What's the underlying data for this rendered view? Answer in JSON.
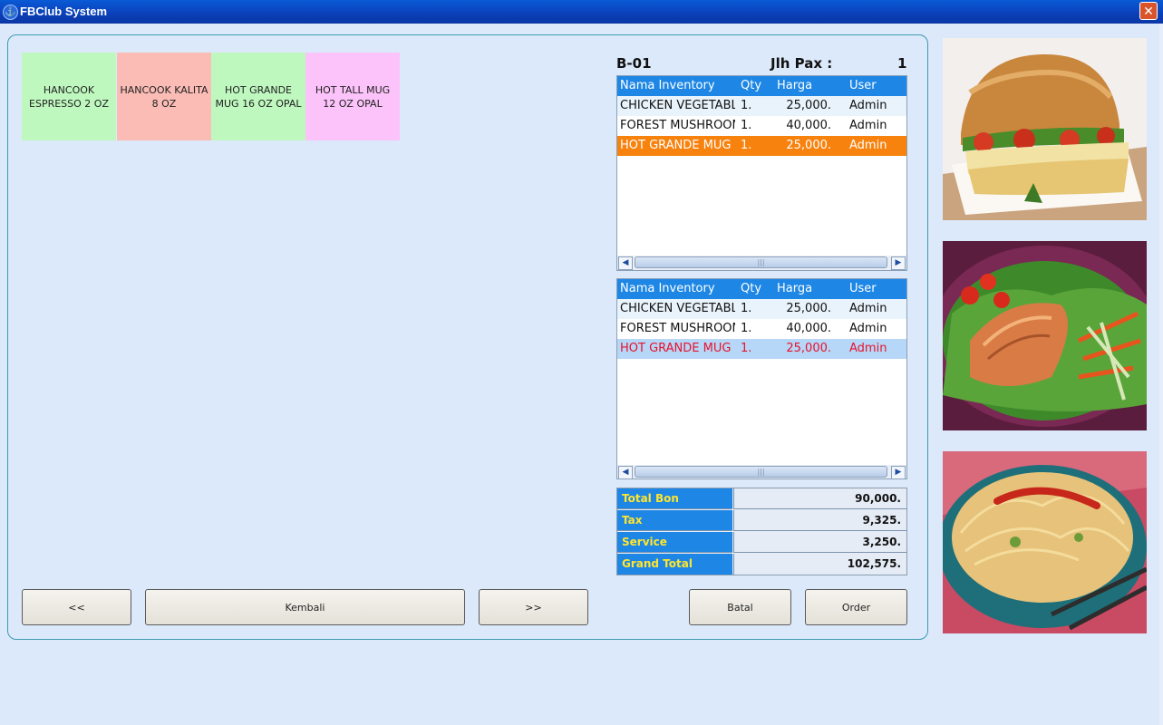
{
  "window": {
    "title": "FBClub System"
  },
  "menu_tiles": [
    {
      "label": "HANCOOK ESPRESSO 2 OZ",
      "color": "#bff8bf"
    },
    {
      "label": "HANCOOK KALITA 8 OZ",
      "color": "#fbbcb6"
    },
    {
      "label": "HOT GRANDE MUG 16 OZ OPAL",
      "color": "#bff8bf"
    },
    {
      "label": "HOT TALL MUG 12 OZ OPAL",
      "color": "#fbc3f9"
    }
  ],
  "order_header": {
    "table": "B-01",
    "pax_label": "Jlh Pax :",
    "pax_value": "1"
  },
  "columns": [
    "Nama Inventory",
    "Qty",
    "Harga",
    "User"
  ],
  "grid_top": {
    "rows": [
      {
        "name": "CHICKEN VEGETABLE",
        "qty": "1.",
        "price": "25,000.",
        "user": "Admin"
      },
      {
        "name": "FOREST MUSHROOM",
        "qty": "1.",
        "price": "40,000.",
        "user": "Admin"
      },
      {
        "name": "HOT GRANDE MUG",
        "qty": "1.",
        "price": "25,000.",
        "user": "Admin"
      }
    ]
  },
  "grid_bottom": {
    "rows": [
      {
        "name": "CHICKEN VEGETABLE",
        "qty": "1.",
        "price": "25,000.",
        "user": "Admin"
      },
      {
        "name": "FOREST MUSHROOM",
        "qty": "1.",
        "price": "40,000.",
        "user": "Admin"
      },
      {
        "name": "HOT GRANDE MUG",
        "qty": "1.",
        "price": "25,000.",
        "user": "Admin"
      }
    ]
  },
  "totals": [
    {
      "label": "Total Bon",
      "value": "90,000."
    },
    {
      "label": "Tax",
      "value": "9,325."
    },
    {
      "label": "Service",
      "value": "3,250."
    },
    {
      "label": "Grand Total",
      "value": "102,575."
    }
  ],
  "buttons": {
    "prev": "<<",
    "back": "Kembali",
    "next": ">>",
    "cancel": "Batal",
    "order": "Order"
  },
  "colors": {
    "selected_row": "#f7820e",
    "highlight_row": "#b6d7f7",
    "highlight_text": "#e8112d",
    "header": "#1e87e5"
  }
}
